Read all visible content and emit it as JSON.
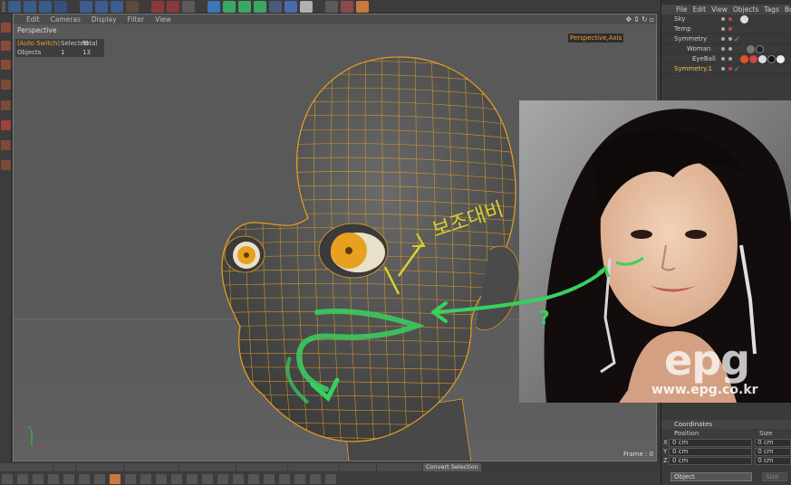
{
  "viewport": {
    "menu": [
      "Edit",
      "Cameras",
      "Display",
      "Filter",
      "View"
    ],
    "nav_icons": [
      "move-view-icon",
      "zoom-view-icon",
      "rotate-view-icon",
      "maximize-view-icon"
    ],
    "camera_label": "Perspective",
    "camera_tag": "Perspective,Axis",
    "frame_label": "Frame : 0",
    "info_table": {
      "headers": [
        "(Auto Switch)",
        "Selected",
        "Total"
      ],
      "row": [
        "Objects",
        "1",
        "13"
      ]
    }
  },
  "photo": {
    "watermark": "epg",
    "url": "www.epg.co.kr"
  },
  "annotation": {
    "korean_text": "보조대비",
    "question": "?"
  },
  "object_manager": {
    "menu": [
      "File",
      "Edit",
      "View",
      "Objects",
      "Tags",
      "Bo"
    ],
    "objects": [
      {
        "name": "Sky",
        "indent": 0
      },
      {
        "name": "Temp",
        "indent": 0
      },
      {
        "name": "Symmetry",
        "indent": 0
      },
      {
        "name": "Woman",
        "indent": 1
      },
      {
        "name": "EyeBall",
        "indent": 2
      },
      {
        "name": "Symmetry.1",
        "indent": 0
      }
    ]
  },
  "attributes": {
    "section": "Coordinates",
    "columns": [
      "Position",
      "Size"
    ],
    "rows": [
      {
        "axis": "X",
        "position": "0 cm",
        "size": "0 cm"
      },
      {
        "axis": "Y",
        "position": "0 cm",
        "size": "0 cm"
      },
      {
        "axis": "Z",
        "position": "0 cm",
        "size": "0 cm"
      }
    ],
    "mode_select": "Object",
    "size_button": "Size"
  },
  "status_bar": {
    "active_item": "Convert Selection"
  },
  "colors": {
    "accent_orange": "#f0a030",
    "wire_orange": "#e8a020",
    "annotation_green": "#38d060",
    "annotation_yellow": "#d8d030"
  }
}
